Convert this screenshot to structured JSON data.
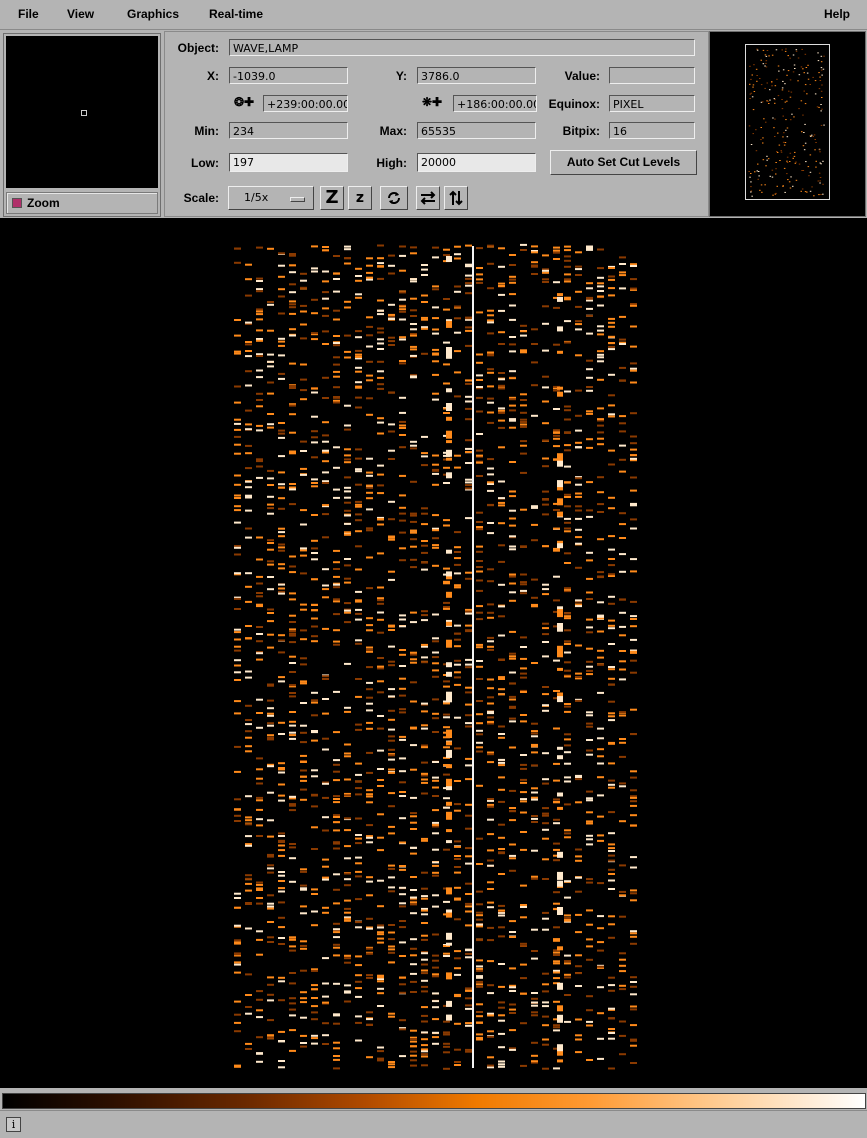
{
  "menu": {
    "file": "File",
    "view": "View",
    "graphics": "Graphics",
    "realtime": "Real-time",
    "help": "Help"
  },
  "zoom": {
    "label": "Zoom"
  },
  "info": {
    "object_label": "Object:",
    "object_value": "WAVE,LAMP",
    "x_label": "X:",
    "x_value": "-1039.0",
    "y_label": "Y:",
    "y_value": "3786.0",
    "value_label": "Value:",
    "value_value": "",
    "ra_value": "+239:00:00.00",
    "dec_value": "+186:00:00.00",
    "equinox_label": "Equinox:",
    "equinox_value": "PIXEL",
    "min_label": "Min:",
    "min_value": "234",
    "max_label": "Max:",
    "max_value": "65535",
    "bitpix_label": "Bitpix:",
    "bitpix_value": "16",
    "low_label": "Low:",
    "low_value": "197",
    "high_label": "High:",
    "high_value": "20000",
    "auto_cut_label": "Auto Set Cut Levels",
    "scale_label": "Scale:",
    "scale_value": "1/5x"
  },
  "toolbar_icons": {
    "zoom_in": "Z",
    "zoom_out": "z",
    "status_info": "i"
  },
  "colors": {
    "background": "#b4b4b4",
    "image_bg": "#000000",
    "line_dim": "#8a3a00",
    "line_mid": "#ff8a1a",
    "line_bright": "#ffe9cc"
  }
}
